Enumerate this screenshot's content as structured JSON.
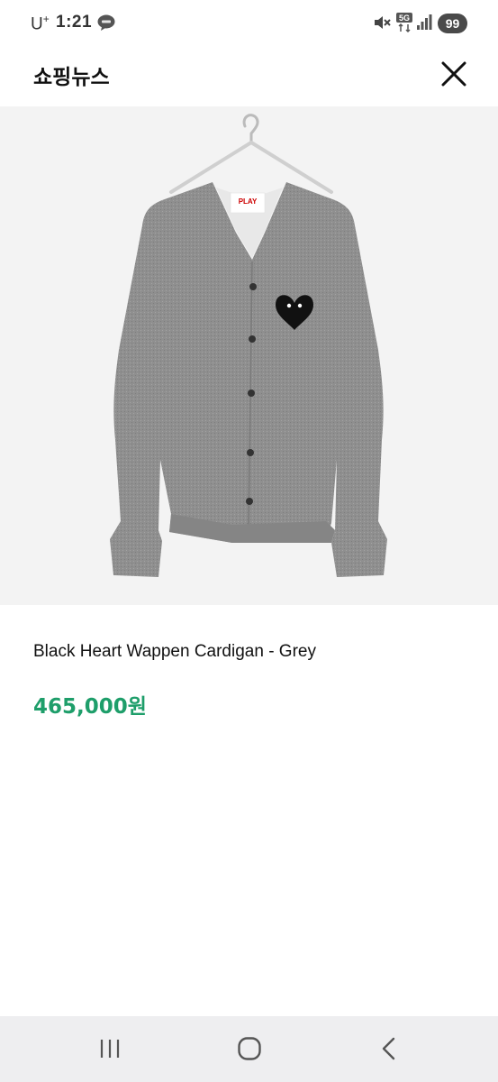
{
  "status_bar": {
    "carrier": "U",
    "carrier_sup": "+",
    "time": "1:21",
    "battery": "99",
    "icons": [
      "talk-icon",
      "mute-icon",
      "5g-network-icon",
      "signal-icon"
    ]
  },
  "header": {
    "title": "쇼핑뉴스",
    "close_icon": "close-icon"
  },
  "product": {
    "image_label_brand": "PLAY",
    "name": "Black Heart Wappen Cardigan - Grey",
    "price": "465,000원"
  },
  "nav_bar": {
    "icons": [
      "recent-apps-icon",
      "home-icon",
      "back-icon"
    ]
  },
  "colors": {
    "price": "#1e9e6a",
    "image_background": "#f3f3f3",
    "cardigan": "#8f8f8f",
    "nav_background": "#eeeef0"
  }
}
